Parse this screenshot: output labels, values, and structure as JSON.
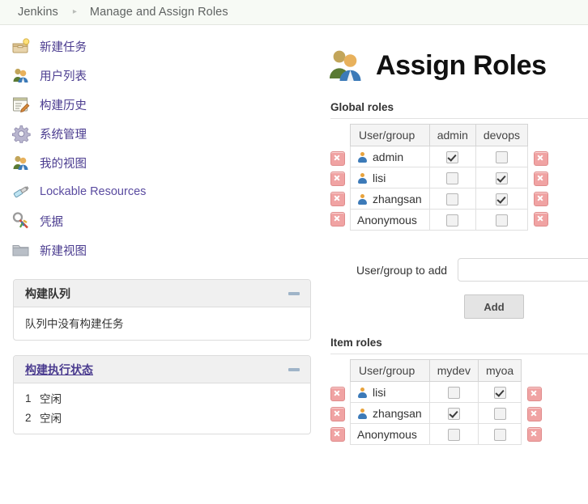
{
  "breadcrumb": {
    "root": "Jenkins",
    "separator": "▸",
    "current": "Manage and Assign Roles"
  },
  "sidebar": {
    "nav": [
      {
        "label": "新建任务",
        "icon": "new-job-icon"
      },
      {
        "label": "用户列表",
        "icon": "people-icon"
      },
      {
        "label": "构建历史",
        "icon": "build-history-icon"
      },
      {
        "label": "系统管理",
        "icon": "gear-icon"
      },
      {
        "label": "我的视图",
        "icon": "people-icon"
      },
      {
        "label": "Lockable Resources",
        "icon": "usb-lock-icon"
      },
      {
        "label": "凭据",
        "icon": "credentials-key-icon"
      },
      {
        "label": "新建视图",
        "icon": "folder-icon"
      }
    ],
    "build_queue": {
      "title": "构建队列",
      "empty_text": "队列中没有构建任务"
    },
    "build_executor": {
      "title": "构建执行状态",
      "executors": [
        {
          "num": "1",
          "state": "空闲"
        },
        {
          "num": "2",
          "state": "空闲"
        }
      ]
    }
  },
  "main": {
    "title": "Assign Roles",
    "title_icon": "people-large-icon",
    "global_roles": {
      "label": "Global roles",
      "columns": [
        "User/group",
        "admin",
        "devops"
      ],
      "rows": [
        {
          "user": "admin",
          "has_user_icon": true,
          "checks": [
            true,
            false
          ]
        },
        {
          "user": "lisi",
          "has_user_icon": true,
          "checks": [
            false,
            true
          ]
        },
        {
          "user": "zhangsan",
          "has_user_icon": true,
          "checks": [
            false,
            true
          ]
        },
        {
          "user": "Anonymous",
          "has_user_icon": false,
          "checks": [
            false,
            false
          ]
        }
      ]
    },
    "add_form": {
      "label": "User/group to add",
      "value": "",
      "placeholder": "",
      "button": "Add"
    },
    "item_roles": {
      "label": "Item roles",
      "columns": [
        "User/group",
        "mydev",
        "myoa"
      ],
      "rows": [
        {
          "user": "lisi",
          "has_user_icon": true,
          "checks": [
            false,
            true
          ]
        },
        {
          "user": "zhangsan",
          "has_user_icon": true,
          "checks": [
            true,
            false
          ]
        },
        {
          "user": "Anonymous",
          "has_user_icon": false,
          "checks": [
            false,
            false
          ]
        }
      ]
    }
  },
  "colors": {
    "link": "#4a3b8f",
    "breadcrumb_bg": "#f7faf5",
    "panel_head_bg": "#f0f0f0",
    "delete_btn": "#f0a3a3",
    "table_header_bg": "#f4f4f4"
  }
}
